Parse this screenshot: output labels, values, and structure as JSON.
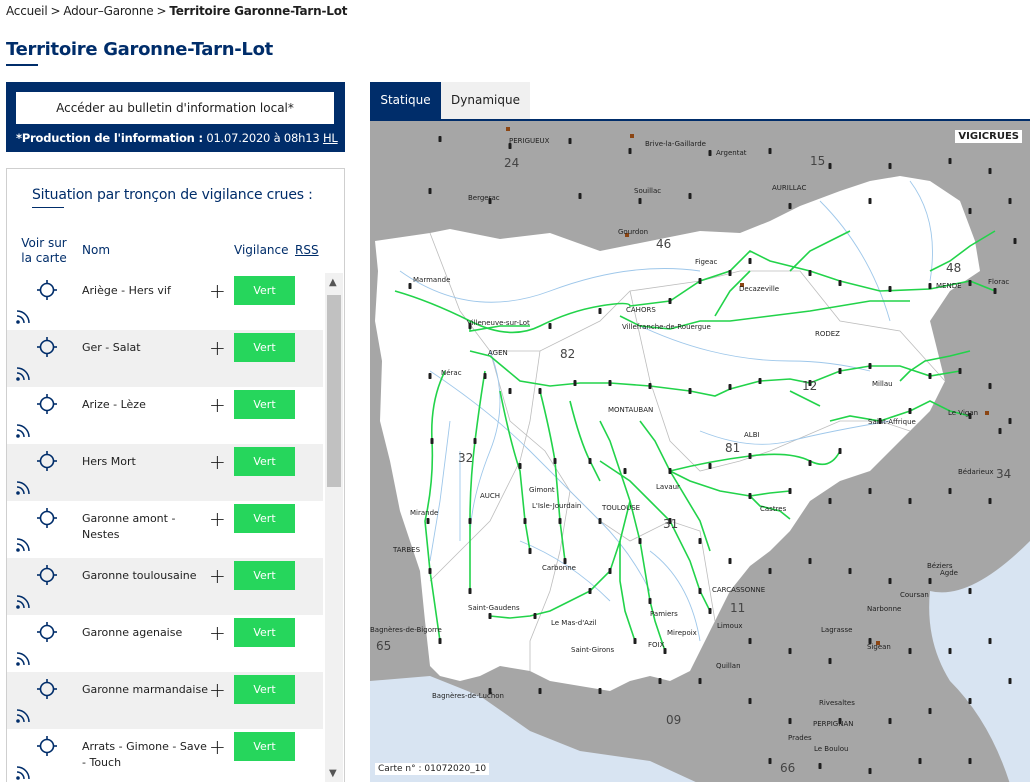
{
  "breadcrumb": {
    "home": "Accueil",
    "sep": ">",
    "parent": "Adour–Garonne",
    "current": "Territoire Garonne-Tarn-Lot"
  },
  "page_title": "Territoire Garonne-Tarn-Lot",
  "bulletin": {
    "button_label": "Accéder au bulletin d'information local*",
    "production_label": "*Production de l'information :",
    "production_date": "01.07.2020 à 08h13",
    "production_tz": "HL"
  },
  "situation": {
    "title": "Situation par tronçon de vigilance crues :",
    "columns": {
      "voir": "Voir sur la carte",
      "nom": "Nom",
      "vigilance": "Vigilance",
      "rss": "RSS"
    },
    "rows": [
      {
        "name": "Ariège - Hers vif",
        "vigilance": "Vert"
      },
      {
        "name": "Ger - Salat",
        "vigilance": "Vert"
      },
      {
        "name": "Arize - Lèze",
        "vigilance": "Vert"
      },
      {
        "name": "Hers Mort",
        "vigilance": "Vert"
      },
      {
        "name": "Garonne amont - Nestes",
        "vigilance": "Vert"
      },
      {
        "name": "Garonne toulousaine",
        "vigilance": "Vert"
      },
      {
        "name": "Garonne agenaise",
        "vigilance": "Vert"
      },
      {
        "name": "Garonne marmandaise",
        "vigilance": "Vert"
      },
      {
        "name": "Arrats - Gimone - Save - Touch",
        "vigilance": "Vert"
      }
    ],
    "vigilance_color": "#26d65c"
  },
  "tabs": [
    {
      "label": "Statique",
      "active": true
    },
    {
      "label": "Dynamique",
      "active": false
    }
  ],
  "map": {
    "logo": "VIGICRUES",
    "map_number": "Carte n° : 01072020_10",
    "departments": [
      "24",
      "15",
      "46",
      "48",
      "82",
      "12",
      "32",
      "81",
      "34",
      "31",
      "11",
      "65",
      "09",
      "66"
    ],
    "places": [
      "PERIGUEUX",
      "Brive-la-Gaillarde",
      "Argentat",
      "Bergerac",
      "Souillac",
      "AURILLAC",
      "Gourdon",
      "Marmande",
      "Figeac",
      "Decazeville",
      "MENDE",
      "Florac",
      "CAHORS",
      "Villeneuve-sur-Lot",
      "Villefranche-de-Rouergue",
      "RODEZ",
      "AGEN",
      "Nérac",
      "MONTAUBAN",
      "Millau",
      "Le Vigan",
      "Saint-Affrique",
      "ALBI",
      "AUCH",
      "Gimont",
      "L'Isle-Jourdain",
      "TOULOUSE",
      "Lavaur",
      "Bédarieux",
      "Mirande",
      "Castres",
      "TARBES",
      "Carbonne",
      "CARCASSONNE",
      "Béziers",
      "Agde",
      "Saint-Gaudens",
      "Le Mas-d'Azil",
      "Pamiers",
      "Narbonne",
      "Coursan",
      "Limoux",
      "Lagrasse",
      "Bagnères-de-Bigorre",
      "Saint-Girons",
      "FOIX",
      "Mirepoix",
      "Sigean",
      "Quillan",
      "Bagnères-de-Luchon",
      "Rivesaltes",
      "PERPIGNAN",
      "Prades",
      "Le Boulou"
    ]
  }
}
